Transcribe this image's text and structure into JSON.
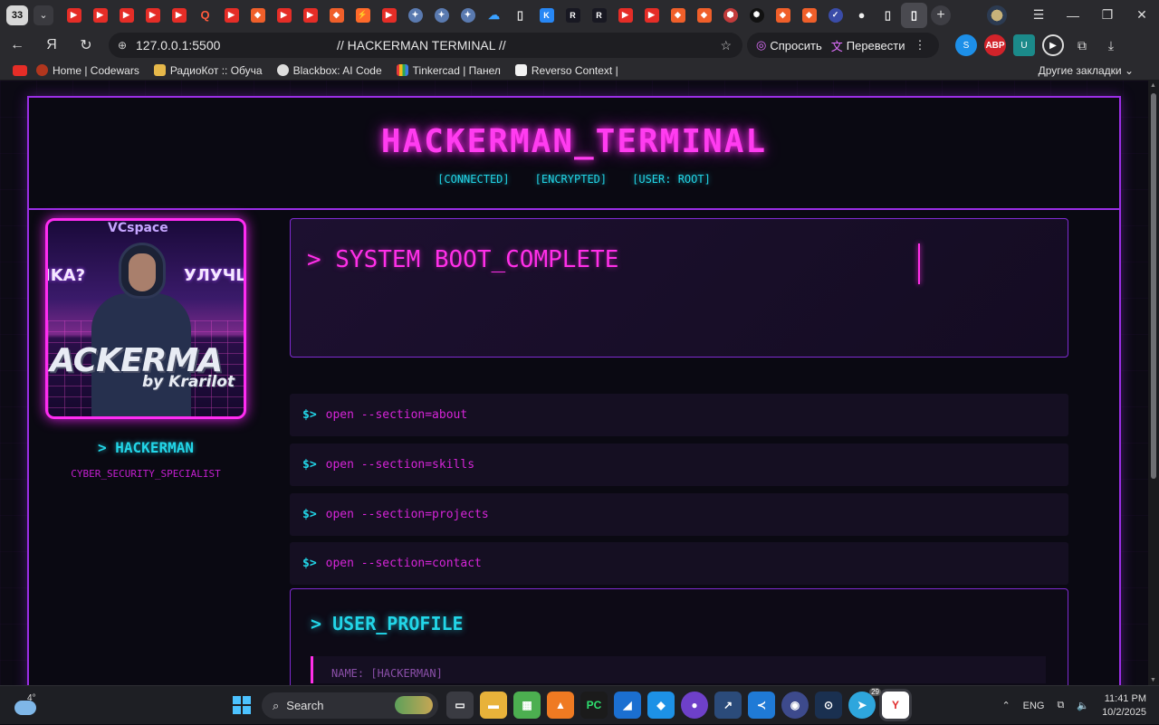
{
  "browser": {
    "tab_count": "33",
    "url": "127.0.0.1:5500",
    "page_title": "// HACKERMAN TERMINAL //",
    "ask_label": "Спросить",
    "translate_label": "Перевести",
    "extension_badge": "ABP",
    "bookmarks": [
      "Home | Codewars",
      "РадиоКот :: Обуча",
      "Blackbox: AI Code",
      "Tinkercad | Панел",
      "Reverso Context |"
    ],
    "other_bookmarks": "Другие закладки"
  },
  "page": {
    "title": "HACKERMAN_TERMINAL",
    "status": [
      "[CONNECTED]",
      "[ENCRYPTED]",
      "[USER: ROOT]"
    ],
    "avatar_texts": {
      "top": "VCspace",
      "left": "IKA?",
      "right": "УЛУЧШ",
      "big": "ACKERMA",
      "by": "by Krarilot"
    },
    "user_name": "> HACKERMAN",
    "user_role": "CYBER_SECURITY_SPECIALIST",
    "boot_message": "> SYSTEM BOOT_COMPLETE",
    "commands": [
      {
        "prompt": "$>",
        "text": "open --section=about"
      },
      {
        "prompt": "$>",
        "text": "open --section=skills"
      },
      {
        "prompt": "$>",
        "text": "open --section=projects"
      },
      {
        "prompt": "$>",
        "text": "open --section=contact"
      }
    ],
    "profile_title": "> USER_PROFILE",
    "profile_line": "NAME: [HACKERMAN]",
    "colors": {
      "magenta": "#ff2fe8",
      "cyan": "#22d6e8",
      "border": "#9b2ee6",
      "background": "#0a0912"
    }
  },
  "taskbar": {
    "temperature": "4°",
    "search_placeholder": "Search",
    "telegram_badge": "29",
    "language": "ENG",
    "time": "11:41 PM",
    "date": "10/2/2025"
  }
}
